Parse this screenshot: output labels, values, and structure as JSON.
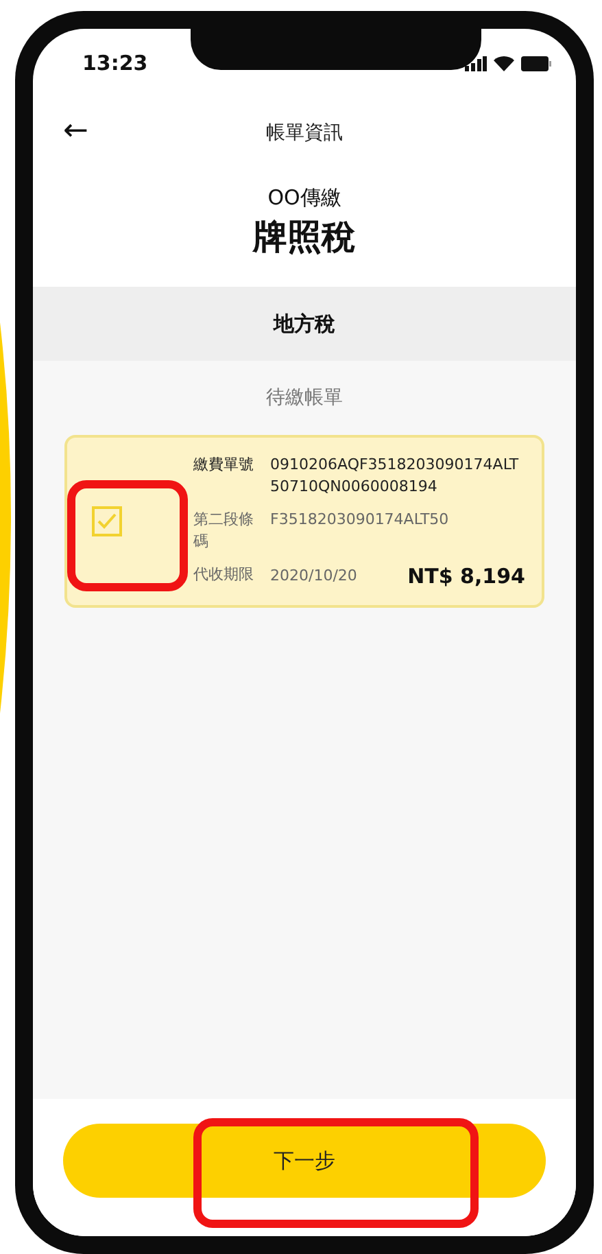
{
  "status_bar": {
    "time": "13:23"
  },
  "header": {
    "back": "←",
    "title": "帳單資訊"
  },
  "biller": {
    "channel": "OO傳繳",
    "name": "牌照稅"
  },
  "section": {
    "title": "地方稅"
  },
  "list_title": "待繳帳單",
  "bills": [
    {
      "checked": true,
      "fields": [
        {
          "label": "繳費單號",
          "value": "0910206AQF3518203090174ALT50710QN0060008194",
          "muted": false
        },
        {
          "label": "第二段條碼",
          "value": "F3518203090174ALT50",
          "muted": true
        },
        {
          "label": "代收期限",
          "value": "2020/10/20",
          "muted": true
        }
      ],
      "amount": "NT$ 8,194"
    }
  ],
  "next_button": "下一步"
}
